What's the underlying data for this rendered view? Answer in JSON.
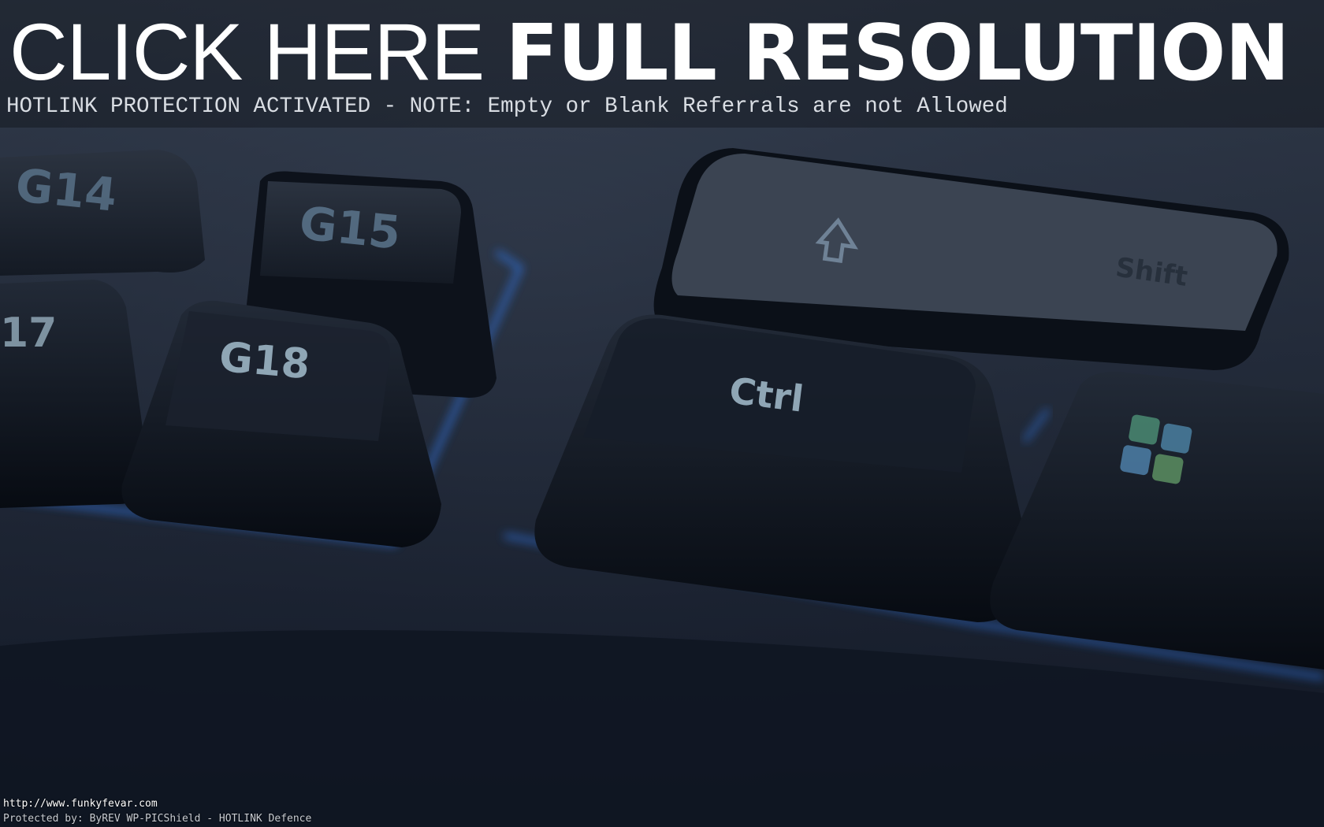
{
  "banner": {
    "headline_thin": "CLICK HERE",
    "headline_bold": "FULL RESOLUTION",
    "notice_prefix": "HOTLINK PROTECTION ACTIVATED - ",
    "notice_note": "NOTE:",
    "notice_rest": " Empty or Blank Referrals are not Allowed"
  },
  "photo": {
    "keys": {
      "g14": "G14",
      "g15": "G15",
      "g17": "17",
      "g18": "G18",
      "shift": "Shift",
      "ctrl": "Ctrl"
    },
    "key_legend_color": "#8fa6b5",
    "backlight_color": "#2f6fd6"
  },
  "footer": {
    "url": "http://www.funkyfevar.com",
    "protection": "Protected by: ByREV WP-PICShield - HOTLINK Defence"
  }
}
